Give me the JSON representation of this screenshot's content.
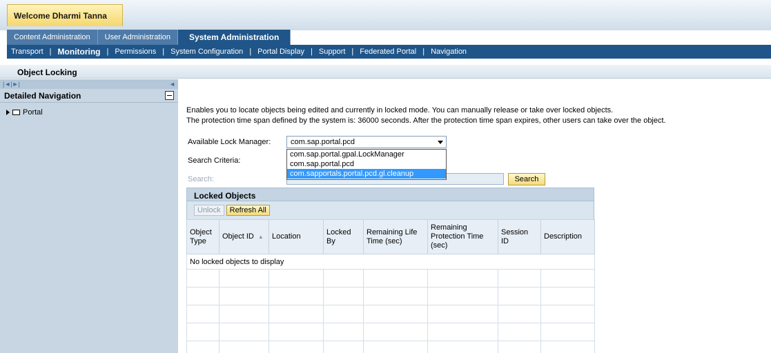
{
  "header": {
    "welcome": "Welcome Dharmi Tanna",
    "top_tabs": [
      {
        "label": "Content Administration",
        "active": false
      },
      {
        "label": "User Administration",
        "active": false
      },
      {
        "label": "System Administration",
        "active": true
      }
    ],
    "subnav": [
      {
        "label": "Transport",
        "bold": false
      },
      {
        "label": "Monitoring",
        "bold": true
      },
      {
        "label": "Permissions",
        "bold": false
      },
      {
        "label": "System Configuration",
        "bold": false
      },
      {
        "label": "Portal Display",
        "bold": false
      },
      {
        "label": "Support",
        "bold": false
      },
      {
        "label": "Federated Portal",
        "bold": false
      },
      {
        "label": "Navigation",
        "bold": false
      }
    ]
  },
  "page_title": "Object Locking",
  "nav": {
    "toggle_left": "|◄|►|",
    "toggle_right": "◄",
    "title": "Detailed Navigation",
    "tree": [
      {
        "label": "Portal"
      }
    ]
  },
  "content": {
    "intro_line1": "Enables you to locate objects being edited and currently in locked mode. You can manually release or take over locked objects.",
    "intro_line2": "The protection time span defined by the system is: 36000 seconds. After the protection time span expires, other users can take over the object.",
    "lock_manager_label": "Available Lock Manager:",
    "lock_manager_value": "com.sap.portal.pcd",
    "lock_manager_options": [
      {
        "label": "com.sap.portal.gpal.LockManager",
        "selected": false
      },
      {
        "label": "com.sap.portal.pcd",
        "selected": false
      },
      {
        "label": "com.sapportals.portal.pcd.gl.cleanup",
        "selected": true
      }
    ],
    "search_criteria_label": "Search Criteria:",
    "search_label": "Search:",
    "search_button": "Search"
  },
  "locked_objects": {
    "title": "Locked Objects",
    "unlock_label": "Unlock",
    "refresh_label": "Refresh All",
    "columns": [
      "Object Type",
      "Object ID",
      "Location",
      "Locked By",
      "Remaining Life Time (sec)",
      "Remaining Protection Time (sec)",
      "Session ID",
      "Description"
    ],
    "empty_message": "No locked objects to display",
    "sort_indicator": "▲"
  },
  "colors": {
    "nav_blue": "#1f5589",
    "panel_blue": "#c8d6e3",
    "highlight": "#3399ff",
    "button_yellow": "#f4dc7d"
  }
}
